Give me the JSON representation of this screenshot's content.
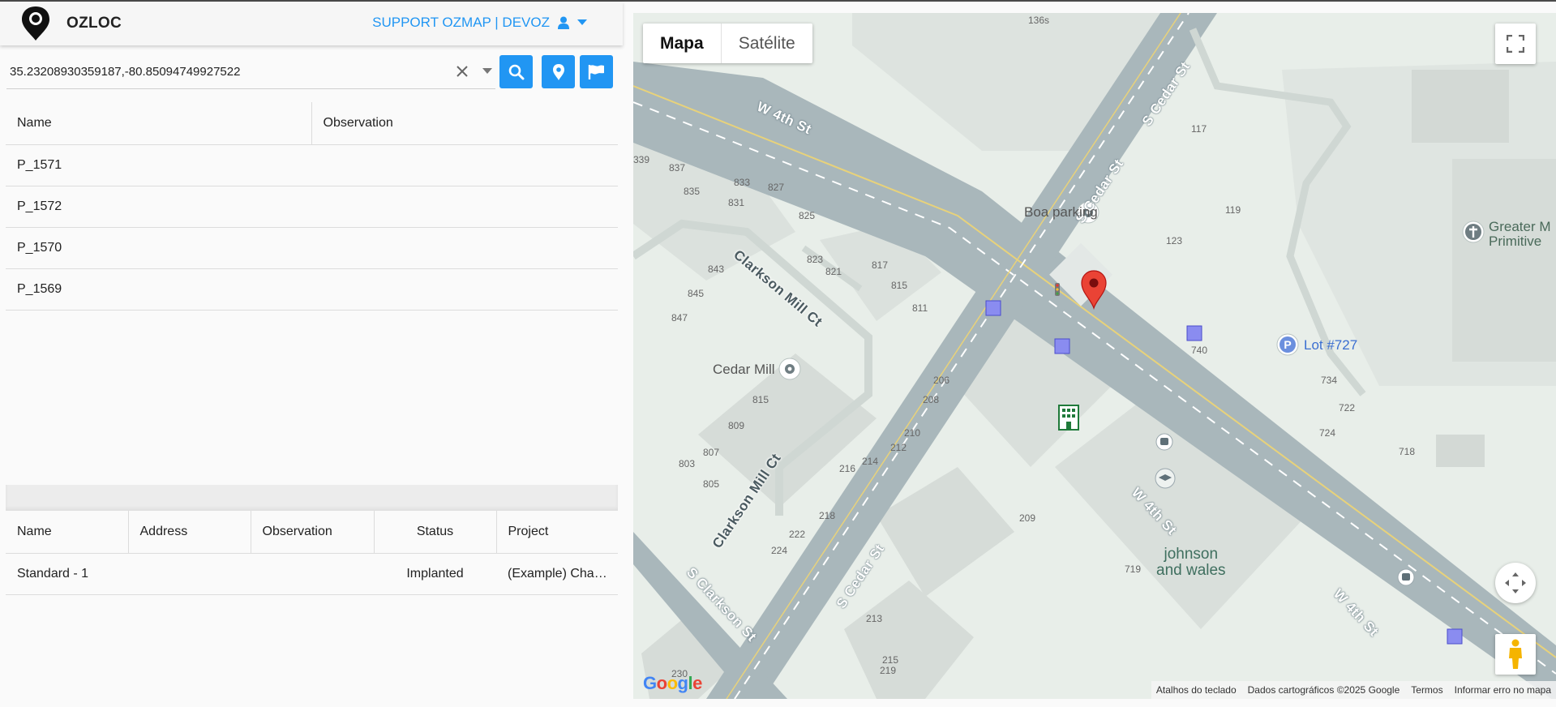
{
  "header": {
    "app_name": "OZLOC",
    "user_label": "SUPPORT OZMAP | DEVOZ",
    "accent": "#2196f3"
  },
  "search": {
    "value": "35.23208930359187,-80.85094749927522",
    "icons": [
      "close-icon",
      "chevron-down-icon",
      "search-icon",
      "map-pin-icon",
      "flag-icon"
    ]
  },
  "points_table": {
    "headers": [
      "Name",
      "Observation"
    ],
    "rows": [
      {
        "name": "P_1571",
        "observation": ""
      },
      {
        "name": "P_1572",
        "observation": ""
      },
      {
        "name": "P_1570",
        "observation": ""
      },
      {
        "name": "P_1569",
        "observation": ""
      }
    ]
  },
  "projects_table": {
    "headers": [
      "Name",
      "Address",
      "Observation",
      "Status",
      "Project"
    ],
    "rows": [
      {
        "name": "Standard - 1",
        "address": "",
        "observation": "",
        "status": "Implanted",
        "project": "(Example) Cha…"
      }
    ]
  },
  "map": {
    "tabs": [
      "Mapa",
      "Satélite"
    ],
    "active_tab": "Mapa",
    "streets": [
      "W 4th St",
      "S Cedar St",
      "Clarkson Mill Ct",
      "S Clarkson St"
    ],
    "pois": [
      "Boa parking",
      "Cedar Mill",
      "Lot #727",
      "Greater M",
      "Primitive",
      "johnson",
      "and wales"
    ],
    "numbers": [
      "136s",
      "117",
      "119",
      "123",
      "339",
      "837",
      "835",
      "833",
      "831",
      "827",
      "825",
      "823",
      "821",
      "817",
      "815",
      "811",
      "843",
      "845",
      "847",
      "815",
      "809",
      "807",
      "803",
      "805",
      "206",
      "208",
      "210",
      "212",
      "214",
      "216",
      "218",
      "222",
      "224",
      "209",
      "719",
      "734",
      "722",
      "724",
      "718",
      "213",
      "215",
      "219",
      "230",
      "740"
    ],
    "attribution": [
      "Atalhos do teclado",
      "Dados cartográficos ©2025 Google",
      "Termos",
      "Informar erro no mapa"
    ],
    "logo": "Google"
  }
}
